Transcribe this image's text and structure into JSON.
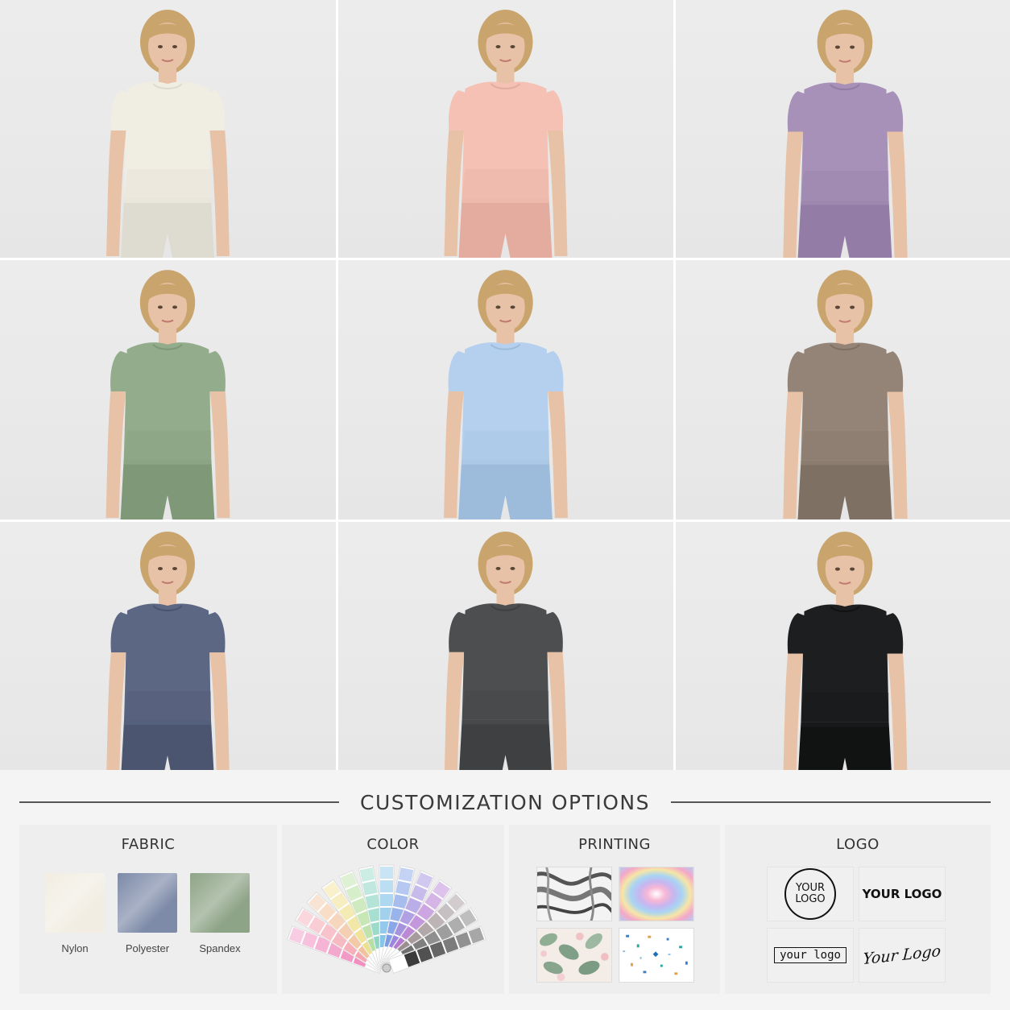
{
  "product_grid": {
    "variants": [
      {
        "shirt": "#f0ede3",
        "shade": "#dedbd0"
      },
      {
        "shirt": "#f4c1b4",
        "shade": "#e3ac9f"
      },
      {
        "shirt": "#a791b8",
        "shade": "#937ca5"
      },
      {
        "shirt": "#93ac8c",
        "shade": "#7f9878"
      },
      {
        "shirt": "#b4d0ee",
        "shade": "#9dbbdb"
      },
      {
        "shirt": "#938477",
        "shade": "#7f7064"
      },
      {
        "shirt": "#5c6784",
        "shade": "#4b5570"
      },
      {
        "shirt": "#4d4e4f",
        "shade": "#3f4041"
      },
      {
        "shirt": "#1d1e1f",
        "shade": "#111212"
      }
    ],
    "skin": "#e8c2a6",
    "hair": "#c9a46c"
  },
  "customization": {
    "heading": "CUSTOMIZATION OPTIONS",
    "fabric": {
      "title": "FABRIC",
      "items": [
        {
          "label": "Nylon",
          "color": "#f1ede2"
        },
        {
          "label": "Polyester",
          "color": "#7d8aa8"
        },
        {
          "label": "Spandex",
          "color": "#8ea487"
        }
      ]
    },
    "color": {
      "title": "COLOR",
      "fan_colors": [
        "#f08fc0",
        "#f4a6b2",
        "#f2c29c",
        "#efe08e",
        "#b7e0a0",
        "#8ed6c4",
        "#86c4e8",
        "#7c9de6",
        "#9a86dc",
        "#b47ad2",
        "#9c8f92",
        "#6f6f6f",
        "#3b3b3b"
      ]
    },
    "printing": {
      "title": "PRINTING",
      "patterns": [
        "marble-print",
        "tie-dye-print",
        "floral-print",
        "terrazzo-print"
      ]
    },
    "logo": {
      "title": "LOGO",
      "circle_line1": "YOUR",
      "circle_line2": "LOGO",
      "bold_text": "YOUR LOGO",
      "boxed_text": "your logo",
      "script_text": "Your Logo"
    }
  }
}
